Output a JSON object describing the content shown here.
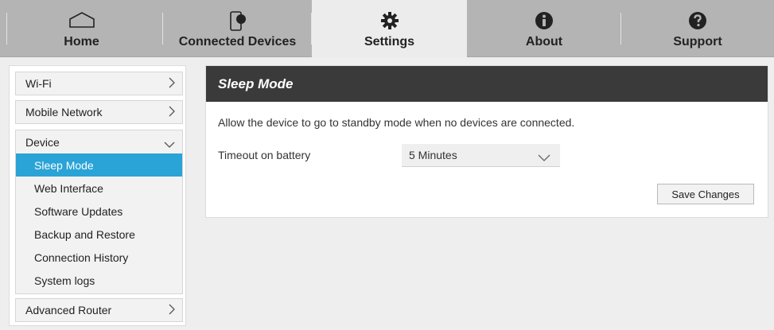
{
  "nav": {
    "tabs": [
      {
        "label": "Home",
        "icon": "home-icon"
      },
      {
        "label": "Connected Devices",
        "icon": "connected-devices-icon"
      },
      {
        "label": "Settings",
        "icon": "gear-icon",
        "active": true
      },
      {
        "label": "About",
        "icon": "info-icon"
      },
      {
        "label": "Support",
        "icon": "question-icon"
      }
    ]
  },
  "sidebar": {
    "wifi": "Wi-Fi",
    "mobile_network": "Mobile Network",
    "device": {
      "label": "Device",
      "items": [
        "Sleep Mode",
        "Web Interface",
        "Software Updates",
        "Backup and Restore",
        "Connection History",
        "System logs"
      ],
      "active": "Sleep Mode"
    },
    "advanced_router": "Advanced Router"
  },
  "main": {
    "title": "Sleep Mode",
    "description": "Allow the device to go to standby mode when no devices are connected.",
    "timeout_label": "Timeout on battery",
    "timeout_value": "5 Minutes",
    "save_label": "Save Changes"
  },
  "colors": {
    "nav_bg": "#b4b4b4",
    "active_tab_bg": "#ececec",
    "accent": "#2aa3d6",
    "panel_header": "#3a3a3a"
  }
}
